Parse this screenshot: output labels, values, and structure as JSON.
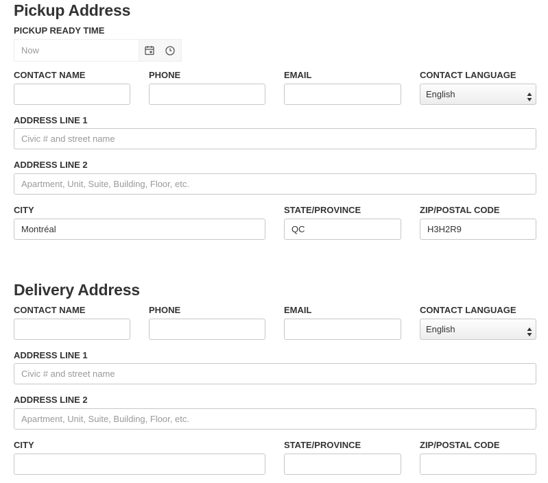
{
  "pickup": {
    "title": "Pickup Address",
    "ready_time_label": "PICKUP READY TIME",
    "ready_time_placeholder": "Now",
    "labels": {
      "contact_name": "CONTACT NAME",
      "phone": "PHONE",
      "email": "EMAIL",
      "contact_language": "CONTACT LANGUAGE",
      "address1": "ADDRESS LINE 1",
      "address2": "ADDRESS LINE 2",
      "city": "CITY",
      "state": "STATE/PROVINCE",
      "zip": "ZIP/POSTAL CODE"
    },
    "values": {
      "contact_name": "",
      "phone": "",
      "email": "",
      "language": "English",
      "address1": "",
      "address2": "",
      "city": "Montréal",
      "state": "QC",
      "zip": "H3H2R9"
    },
    "placeholders": {
      "address1": "Civic # and street name",
      "address2": "Apartment, Unit, Suite, Building, Floor, etc."
    }
  },
  "delivery": {
    "title": "Delivery Address",
    "labels": {
      "contact_name": "CONTACT NAME",
      "phone": "PHONE",
      "email": "EMAIL",
      "contact_language": "CONTACT LANGUAGE",
      "address1": "ADDRESS LINE 1",
      "address2": "ADDRESS LINE 2",
      "city": "CITY",
      "state": "STATE/PROVINCE",
      "zip": "ZIP/POSTAL CODE"
    },
    "values": {
      "contact_name": "",
      "phone": "",
      "email": "",
      "language": "English",
      "address1": "",
      "address2": "",
      "city": "",
      "state": "",
      "zip": ""
    },
    "placeholders": {
      "address1": "Civic # and street name",
      "address2": "Apartment, Unit, Suite, Building, Floor, etc."
    }
  },
  "icons": {
    "date": "calendar-icon",
    "time": "clock-icon",
    "select": "select-arrows-icon"
  }
}
